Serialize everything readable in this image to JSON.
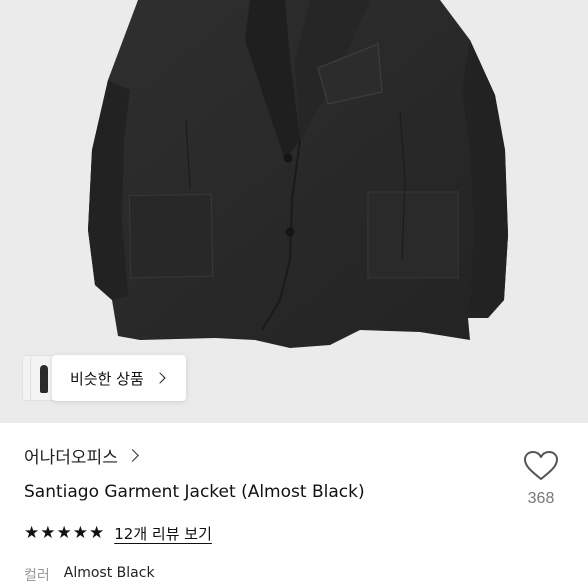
{
  "similar": {
    "label": "비슷한 상품"
  },
  "product": {
    "brand": "어나더오피스",
    "title": "Santiago Garment Jacket (Almost Black)",
    "rating": {
      "stars": 5,
      "review_link": "12개 리뷰 보기"
    },
    "spec": {
      "key": "컬러",
      "value": "Almost Black"
    },
    "like_count": "368"
  },
  "colors": {
    "hero_bg": "#ebebeb",
    "jacket": "#2b2b2b"
  }
}
